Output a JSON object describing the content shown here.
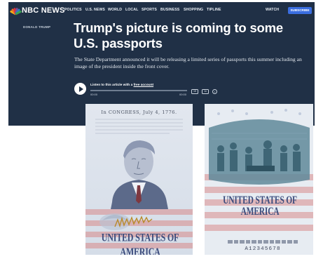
{
  "nav": {
    "logo_text": "NBC NEWS",
    "items": [
      "POLITICS",
      "U.S. NEWS",
      "WORLD",
      "LOCAL",
      "SPORTS",
      "BUSINESS",
      "SHOPPING",
      "TIPLINE"
    ],
    "watch_label": "WATCH",
    "subscribe_label": "SUBSCRIBE"
  },
  "article": {
    "eyebrow": "DONALD TRUMP",
    "headline": "Trump's picture is coming to some U.S. passports",
    "dek": "The State Department announced it will be releasing a limited series of passports this summer including an image of the president inside the front cover."
  },
  "audio": {
    "listen_prefix": "Listen to this article with a ",
    "listen_link": "free account",
    "time_start": "00:00",
    "time_end": "00:00",
    "rewind_label": "15",
    "speed_label": "1x",
    "info_label": "i"
  },
  "passport": {
    "congress_text": "In CONGRESS, July 4, 1776.",
    "country_left": "UNITED STATES OF AMERICA",
    "country_right": "UNITED STATES OF AMERICA",
    "serial": "A12345678"
  },
  "colors": {
    "nav_bg": "#203046",
    "accent": "#3b6ee0",
    "peacock": [
      "#f5b11a",
      "#ee6a24",
      "#d9323e",
      "#7b4d9c",
      "#2c7fc4",
      "#37a650"
    ]
  }
}
